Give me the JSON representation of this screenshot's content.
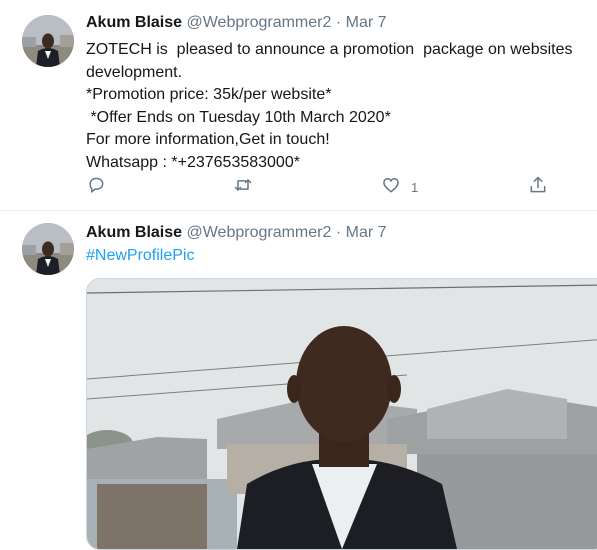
{
  "tweets": [
    {
      "author_name": "Akum Blaise",
      "handle": "@Webprogrammer2",
      "separator": "·",
      "date": "Mar 7",
      "text": "ZOTECH is  pleased to announce a promotion  package on websites development.\n*Promotion price: 35k/per website*\n *Offer Ends on Tuesday 10th March 2020*\nFor more information,Get in touch!\nWhatsapp : *+237653583000*",
      "like_count": "1",
      "actions": [
        "reply-icon",
        "retweet-icon",
        "like-icon",
        "share-icon"
      ]
    },
    {
      "author_name": "Akum Blaise",
      "handle": "@Webprogrammer2",
      "separator": "·",
      "date": "Mar 7",
      "hashtag": "#NewProfilePic"
    }
  ],
  "colors": {
    "text": "#14171a",
    "secondary": "#657786",
    "link": "#1da1f2",
    "divider": "#e6ecf0"
  }
}
